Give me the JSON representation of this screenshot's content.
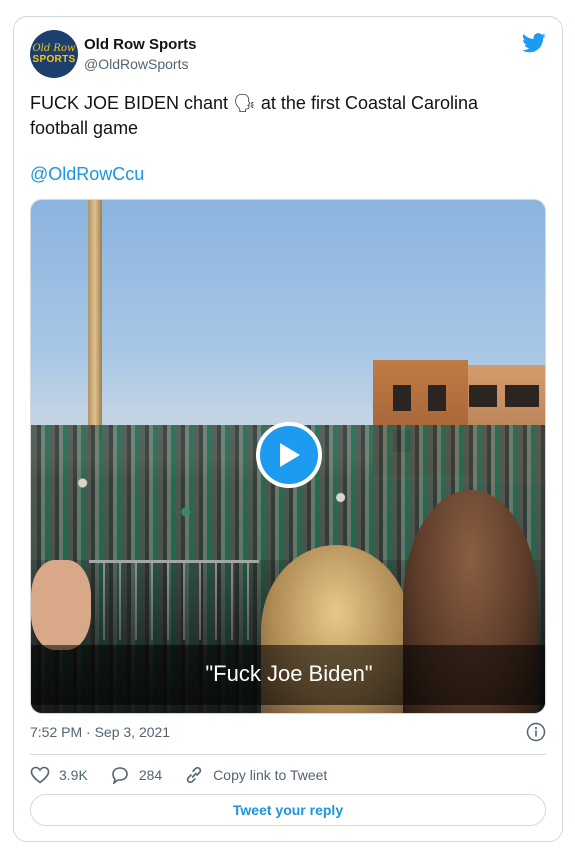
{
  "author": {
    "name": "Old Row Sports",
    "handle": "@OldRowSports",
    "avatar_logo_top": "Old Row",
    "avatar_logo_bottom": "SPORTS"
  },
  "tweet": {
    "text": "FUCK JOE BIDEN chant 🗣 at the first Coastal Carolina football game",
    "mention": "@OldRowCcu"
  },
  "media": {
    "caption": "\"Fuck Joe Biden\"",
    "type": "video"
  },
  "meta": {
    "timestamp": "7:52 PM · Sep 3, 2021"
  },
  "actions": {
    "likes": "3.9K",
    "replies": "284",
    "copy_link": "Copy link to Tweet"
  },
  "reply_button": "Tweet your reply",
  "colors": {
    "accent": "#1d9bf0",
    "link": "#1b95e0",
    "muted": "#536471",
    "border": "#cfd9de"
  },
  "icons": [
    "twitter-bird-icon",
    "play-icon",
    "info-icon",
    "heart-icon",
    "reply-icon",
    "link-icon"
  ]
}
